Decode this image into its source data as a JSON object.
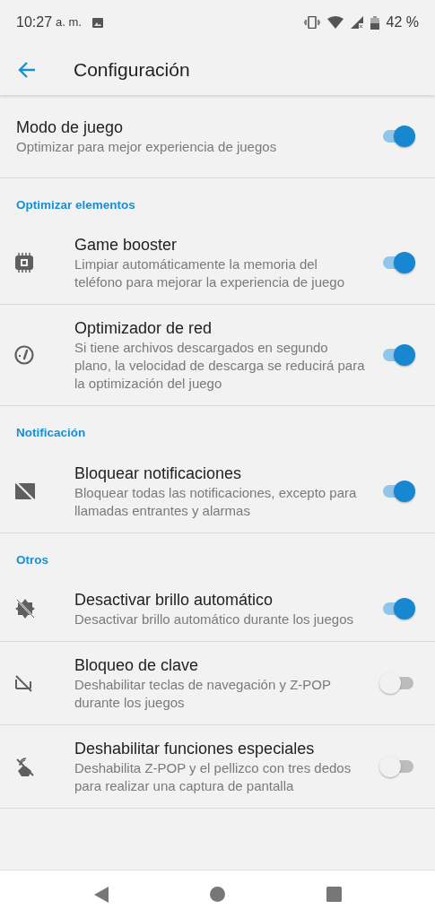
{
  "status_bar": {
    "time": "10:27",
    "ampm": "a. m.",
    "battery": "42 %"
  },
  "toolbar": {
    "title": "Configuración"
  },
  "main_setting": {
    "title": "Modo de juego",
    "description": "Optimizar para mejor experiencia de juegos",
    "on": true
  },
  "sections": [
    {
      "header": "Optimizar elementos",
      "items": [
        {
          "title": "Game booster",
          "description": "Limpiar automáticamente la memoria del teléfono para mejorar la experiencia de juego",
          "on": true
        },
        {
          "title": "Optimizador de red",
          "description": "Si tiene archivos descargados en segundo plano, la velocidad de descarga se reducirá para la optimización del juego",
          "on": true
        }
      ]
    },
    {
      "header": "Notificación",
      "items": [
        {
          "title": "Bloquear notificaciones",
          "description": "Bloquear todas las notificaciones, excepto para llamadas entrantes y alarmas",
          "on": true
        }
      ]
    },
    {
      "header": "Otros",
      "items": [
        {
          "title": "Desactivar brillo automático",
          "description": "Desactivar brillo automático durante los juegos",
          "on": true
        },
        {
          "title": "Bloqueo de clave",
          "description": "Deshabilitar teclas de navegación y Z-POP durante los juegos",
          "on": false
        },
        {
          "title": "Deshabilitar funciones especiales",
          "description": "Deshabilita Z-POP y el pellizco con tres dedos para realizar una captura de pantalla",
          "on": false
        }
      ]
    }
  ]
}
